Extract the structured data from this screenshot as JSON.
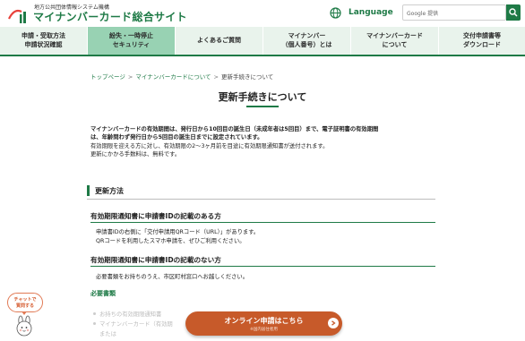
{
  "header": {
    "org": "地方公共団体情報システム機構",
    "site_title": "マイナンバーカード総合サイト",
    "language_label": "Language",
    "search_brand": "Google 提供",
    "search_placeholder": ""
  },
  "nav": {
    "items": [
      {
        "label": "申請・受取方法\n申請状況確認",
        "active": false
      },
      {
        "label": "紛失・一時停止\nセキュリティ",
        "active": true
      },
      {
        "label": "よくあるご質問",
        "active": false
      },
      {
        "label": "マイナンバー\n（個人番号）とは",
        "active": false
      },
      {
        "label": "マイナンバーカード\nについて",
        "active": false
      },
      {
        "label": "交付申請書等\nダウンロード",
        "active": false
      }
    ]
  },
  "breadcrumb": {
    "home": "トップページ",
    "parent": "マイナンバーカードについて",
    "current": "更新手続きについて",
    "separator": ">"
  },
  "page_title": "更新手続きについて",
  "intro": {
    "line1": "マイナンバーカードの有効期間は、発行日から10回目の誕生日（未成年者は5回目）まで、電子証明書の有効期間",
    "line2": "は、年齢問わず発行日から5回目の誕生日までに設定されています。",
    "line3": "有効期限を迎える方に対し、有効期限の2〜3ヶ月前を目途に有効期限通知書が送付されます。",
    "line4": "更新にかかる手数料は、無料です。"
  },
  "section": {
    "title": "更新方法",
    "with_id": {
      "title": "有効期限通知書に申請書IDの記載のある方",
      "line1": "申請書IDの右側に「交付申請用QRコード（URL）」があります。",
      "line2": "QRコードを利用したスマホ申請を、ぜひご利用ください。"
    },
    "without_id": {
      "title": "有効期限通知書に申請書IDの記載のない方",
      "line1": "必要書類をお持ちのうえ、市区町村窓口へお越しください。"
    },
    "required_docs": {
      "title": "必要書類",
      "items": [
        "お持ちの有効期限通知書",
        "マイナンバーカード（有効期",
        "または"
      ]
    }
  },
  "chat": {
    "label": "チャットで\n質問する"
  },
  "online_button": {
    "label": "オンライン申請はこちら",
    "sub": "※国内居住者用"
  },
  "colors": {
    "brand_green": "#1e7a46",
    "nav_bg": "#e9f3ec",
    "nav_active": "#98d2b3",
    "cta_orange": "#c75a2a"
  },
  "icons": {
    "logo": "jlis-logo-icon",
    "globe": "globe-icon",
    "search": "search-icon",
    "arrow": "arrow-right-icon",
    "mascot": "mascot-icon"
  }
}
